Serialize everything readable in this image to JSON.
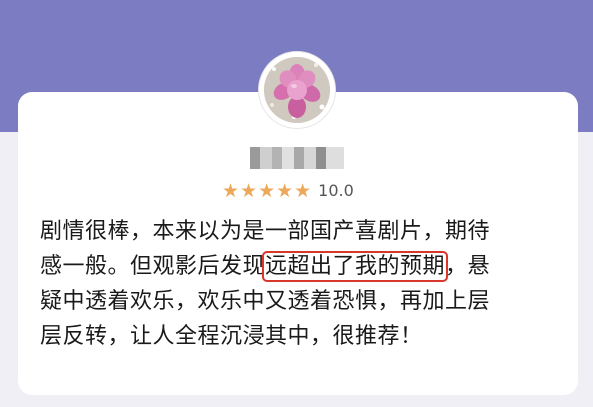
{
  "colors": {
    "header_background": "#7b7cc2",
    "page_background": "#efeff5",
    "card_background": "#ffffff",
    "star_color": "#eda85b",
    "highlight_border": "#d9362c"
  },
  "reviewer": {
    "avatar_icon": "succulent-plant-avatar",
    "name_blurred": true
  },
  "rating": {
    "stars": "★★★★★",
    "star_count": 5,
    "score": "10.0"
  },
  "review": {
    "line1": "剧情很棒，本来以为是一部国产喜剧片，期待",
    "line2_before": "感一般。但观影后发现",
    "line2_highlight": "远超出了我的预期",
    "line2_after": "，悬",
    "line3": "疑中透着欢乐，欢乐中又透着恐惧，再加上层",
    "line4": "层反转，让人全程沉浸其中，很推荐！"
  }
}
